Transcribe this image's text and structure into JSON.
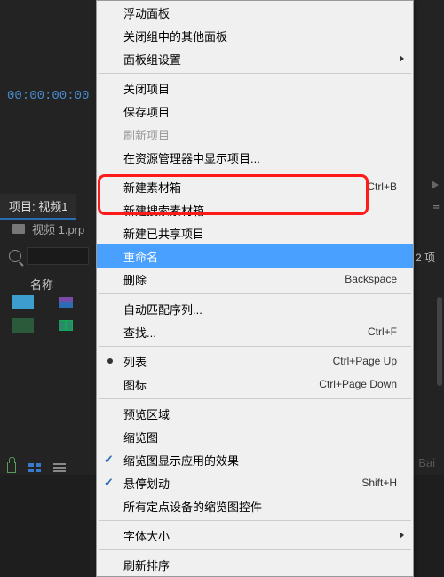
{
  "timecode": "00:00:00:00",
  "project_tab": "项目: 视频1",
  "project_file": "视频 1.prp",
  "items_count_label": "2 项",
  "column_name": "名称",
  "watermark": {
    "main": "Bai",
    "sub": ""
  },
  "menu": {
    "float_panel": "浮动面板",
    "close_others": "关闭组中的其他面板",
    "panel_settings": "面板组设置",
    "close_project": "关闭项目",
    "save_project": "保存项目",
    "refresh_project": "刷新项目",
    "reveal_explorer": "在资源管理器中显示项目...",
    "new_bin": "新建素材箱",
    "new_search_bin": "新建搜索素材箱",
    "new_shared_project": "新建已共享项目",
    "rename": "重命名",
    "delete": "删除",
    "auto_match_seq": "自动匹配序列...",
    "find": "查找...",
    "list_view": "列表",
    "icon_view": "图标",
    "preview_area": "预览区域",
    "thumbnails": "缩览图",
    "thumb_effects": "缩览图显示应用的效果",
    "hover_scrub": "悬停划动",
    "all_thumb_controls": "所有定点设备的缩览图控件",
    "font_size": "字体大小",
    "refresh_sort": "刷新排序",
    "sc_new_bin": "Ctrl+B",
    "sc_delete": "Backspace",
    "sc_find": "Ctrl+F",
    "sc_list": "Ctrl+Page Up",
    "sc_icon": "Ctrl+Page Down",
    "sc_hover": "Shift+H"
  }
}
